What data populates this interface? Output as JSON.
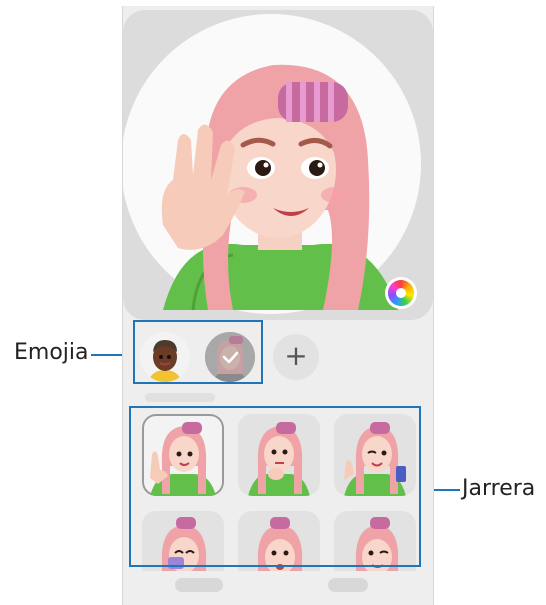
{
  "callouts": {
    "emoji": "Emojia",
    "stickers": "Jarrera"
  },
  "emoji_list": {
    "add_button": "+",
    "selected_index": 1
  },
  "sticker_list": {
    "selected_index": 0
  },
  "colors": {
    "callout": "#1f75b8",
    "hair": "#f0a3a7",
    "sweater": "#62c04a",
    "curler": "#c66aa0"
  },
  "icons": {
    "color_picker": "color-wheel-icon",
    "add": "plus-icon",
    "selected": "check-icon"
  }
}
